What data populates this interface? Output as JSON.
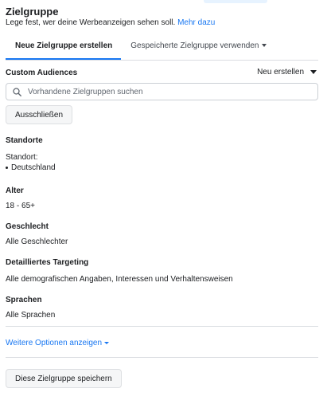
{
  "header": {
    "title": "Zielgruppe",
    "subtitle": "Lege fest, wer deine Werbeanzeigen sehen soll.",
    "learn_more": "Mehr dazu"
  },
  "tabs": [
    {
      "label": "Neue Zielgruppe erstellen",
      "active": true
    },
    {
      "label": "Gespeicherte Zielgruppe verwenden",
      "active": false
    }
  ],
  "custom_audiences": {
    "label": "Custom Audiences",
    "create_new": "Neu erstellen",
    "search_placeholder": "Vorhandene Zielgruppen suchen",
    "exclude_button": "Ausschließen"
  },
  "locations": {
    "label": "Standorte",
    "sub_label": "Standort:",
    "items": [
      "Deutschland"
    ]
  },
  "age": {
    "label": "Alter",
    "value": "18 - 65+"
  },
  "gender": {
    "label": "Geschlecht",
    "value": "Alle Geschlechter"
  },
  "detailed_targeting": {
    "label": "Detailliertes Targeting",
    "value": "Alle demografischen Angaben, Interessen und Verhaltensweisen"
  },
  "languages": {
    "label": "Sprachen",
    "value": "Alle Sprachen"
  },
  "more_options": "Weitere Optionen anzeigen",
  "save_button": "Diese Zielgruppe speichern",
  "colors": {
    "link": "#1877f2",
    "text": "#1c1e21",
    "button_bg": "#f5f6f7",
    "border": "#dadde1"
  }
}
